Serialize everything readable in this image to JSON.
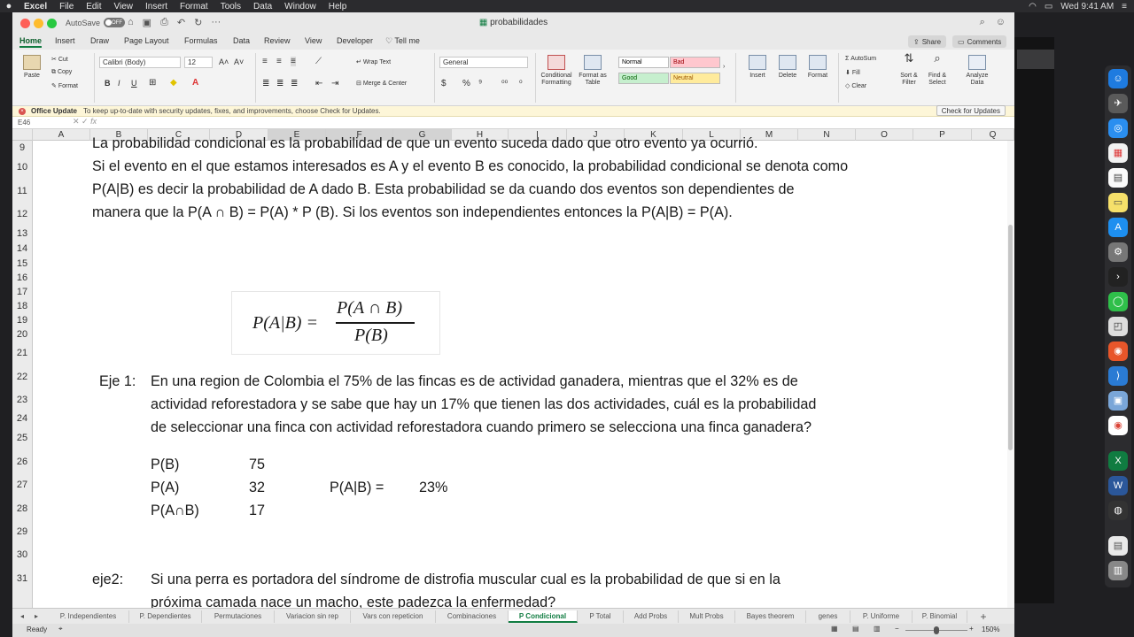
{
  "menubar": {
    "apple": "",
    "app": "Excel",
    "items": [
      "File",
      "Edit",
      "View",
      "Insert",
      "Format",
      "Tools",
      "Data",
      "Window",
      "Help"
    ],
    "clock": "Wed 9:41 AM"
  },
  "titlebar": {
    "autosave_label": "AutoSave",
    "autosave_state": "OFF",
    "doc_title": "probabilidades"
  },
  "ribbon_tabs": [
    "Home",
    "Insert",
    "Draw",
    "Page Layout",
    "Formulas",
    "Data",
    "Review",
    "View",
    "Developer",
    "Tell me"
  ],
  "share_label": "Share",
  "comments_label": "Comments",
  "ribbon": {
    "paste": "Paste",
    "cut": "Cut",
    "copy": "Copy",
    "format": "Format",
    "font_name": "Calibri (Body)",
    "font_size": "12",
    "wrap_text": "Wrap Text",
    "merge_center": "Merge & Center",
    "number_format": "General",
    "conditional_formatting": "Conditional Formatting",
    "format_as_table": "Format as Table",
    "styles": {
      "normal": "Normal",
      "bad": "Bad",
      "good": "Good",
      "neutral": "Neutral"
    },
    "insert": "Insert",
    "delete": "Delete",
    "format_cells": "Format",
    "autosum": "AutoSum",
    "fill": "Fill",
    "clear": "Clear",
    "sort_filter": "Sort & Filter",
    "find_select": "Find & Select",
    "analyze_data": "Analyze Data"
  },
  "update_bar": {
    "title": "Office Update",
    "message": "To keep up-to-date with security updates, fixes, and improvements, choose Check for Updates.",
    "button": "Check for Updates"
  },
  "name_box": "E46",
  "fx": "fx",
  "columns": [
    "A",
    "B",
    "C",
    "D",
    "E",
    "F",
    "G",
    "H",
    "I",
    "J",
    "K",
    "L",
    "M",
    "N",
    "O",
    "P",
    "Q"
  ],
  "rows": [
    "9",
    "10",
    "11",
    "12",
    "13",
    "14",
    "15",
    "16",
    "17",
    "18",
    "19",
    "20",
    "21",
    "22",
    "23",
    "24",
    "25",
    "26",
    "27",
    "28",
    "29",
    "30",
    "31"
  ],
  "content": {
    "line1": "La probabilidad condicional es la probabilidad de que un evento suceda dado que otro evento ya ocurrió.",
    "line2": "Si el evento en el que estamos interesados es A y el evento B es conocido, la probabilidad condicional se denota como",
    "line3": "P(A|B) es decir la probabilidad de A dado B. Esta probabilidad se da cuando dos eventos son dependientes de",
    "line4": " manera que la P(A ∩ B) = P(A) * P (B). Si los eventos son independientes entonces la P(A|B) = P(A).",
    "formula_lhs": "P(A|B) =",
    "formula_num": "P(A ∩ B)",
    "formula_den": "P(B)",
    "eje1_label": "Eje 1:",
    "eje1_l1": "En una region de Colombia el 75% de las fincas es de actividad ganadera, mientras que el 32% es de",
    "eje1_l2": "actividad reforestadora y se sabe que hay un 17% que tienen  las dos actividades, cuál es la probabilidad",
    "eje1_l3": "de seleccionar una finca con actividad reforestadora cuando primero se selecciona una finca ganadera?",
    "pb_label": "P(B)",
    "pb_val": "75",
    "pa_label": "P(A)",
    "pa_val": "32",
    "pab_label": "P(A∩B)",
    "pab_val": "17",
    "result_label": "P(A|B) =",
    "result_val": "23%",
    "eje2_label": "eje2:",
    "eje2_l1": "Si una perra es portadora del síndrome de distrofia muscular cual es la probabilidad de que si en la",
    "eje2_l2": "próxima camada nace un macho, este padezca la enfermedad?"
  },
  "sheet_tabs": [
    "P. Independientes",
    "P. Dependientes",
    "Permutaciones",
    "Variacion sin rep",
    "Vars con repeticion",
    "Combinaciones",
    "P Condicional",
    "P Total",
    "Add Probs",
    "Mult Probs",
    "Bayes theorem",
    "genes",
    "P. Uniforme",
    "P. Binomial"
  ],
  "active_sheet": "P Condicional",
  "status": {
    "ready": "Ready",
    "zoom": "150%"
  },
  "colors": {
    "excel_green": "#107c41",
    "update_bg": "#fdf6d8",
    "bad": "#ffc7ce",
    "good": "#c6efce",
    "neutral": "#ffeb9c"
  }
}
